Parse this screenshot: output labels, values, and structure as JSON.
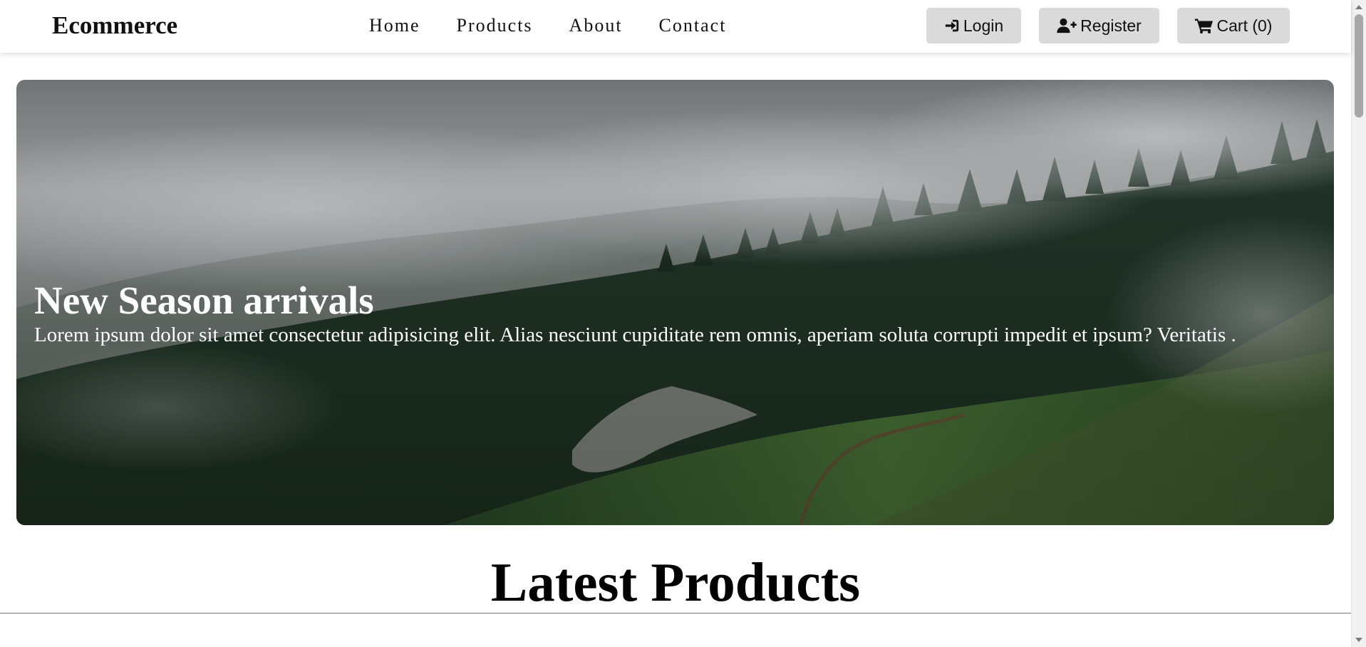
{
  "navbar": {
    "brand": "Ecommerce",
    "links": [
      "Home",
      "Products",
      "About",
      "Contact"
    ],
    "login_label": "Login",
    "register_label": "Register",
    "cart_label": "Cart (0)",
    "login_icon": "sign-in-icon",
    "register_icon": "user-plus-icon",
    "cart_icon": "shopping-cart-icon"
  },
  "hero": {
    "title": "New Season arrivals",
    "text": "Lorem ipsum dolor sit amet consectetur adipisicing elit. Alias nesciunt cupiditate rem omnis, aperiam soluta corrupti impedit et ipsum? Veritatis .",
    "image": "misty-forest-hillside"
  },
  "latest": {
    "title": "Latest Products"
  },
  "colors": {
    "button_bg": "#dadada",
    "hero_text": "#ffffff"
  }
}
